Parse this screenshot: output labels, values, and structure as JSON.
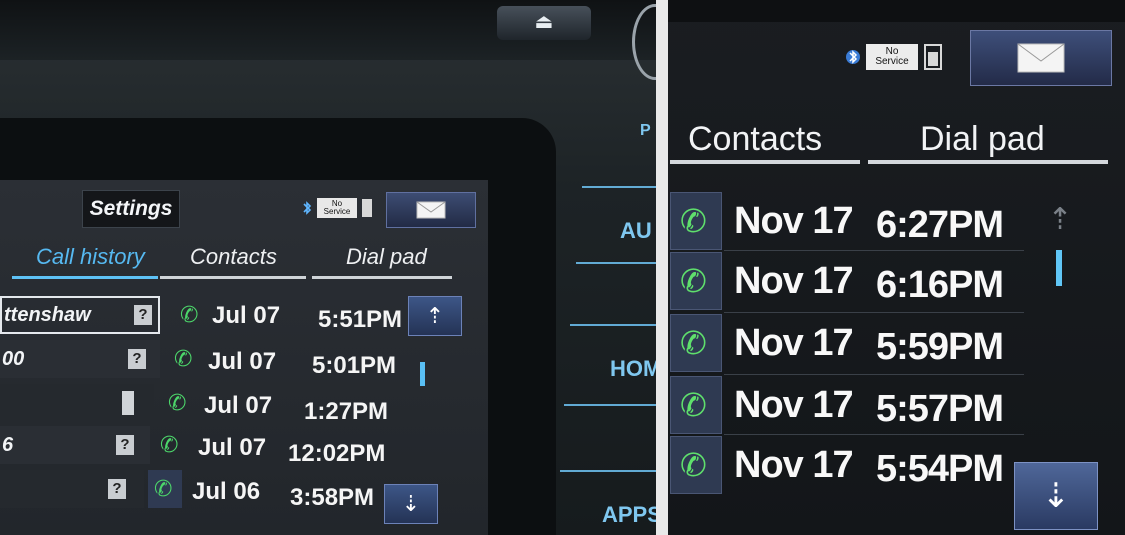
{
  "left_photo": {
    "settings_label": "Settings",
    "status": {
      "no_service": "No Service"
    },
    "tabs": [
      {
        "label": "Call history",
        "active": true
      },
      {
        "label": "Contacts",
        "active": false
      },
      {
        "label": "Dial pad",
        "active": false
      }
    ],
    "history_rows": [
      {
        "name": "ttenshaw",
        "badge": "?",
        "date": "Jul 07",
        "time": "5:51PM"
      },
      {
        "name": "00",
        "badge": "?",
        "date": "Jul 07",
        "time": "5:01PM"
      },
      {
        "name": "",
        "badge": "phone",
        "date": "Jul 07",
        "time": "1:27PM"
      },
      {
        "name": "6",
        "badge": "?",
        "date": "Jul 07",
        "time": "12:02PM"
      },
      {
        "name": "",
        "badge": "?",
        "date": "Jul 06",
        "time": "3:58PM"
      }
    ],
    "hardware_buttons": [
      "AU",
      "HOM",
      "APPS",
      "P"
    ],
    "colors": {
      "accent": "#56b9f1",
      "call_icon": "#4cd66a",
      "scroll_button": "#3d5687"
    }
  },
  "right_photo": {
    "status": {
      "no_service": "No Service"
    },
    "tabs": [
      {
        "label": "Contacts"
      },
      {
        "label": "Dial pad"
      }
    ],
    "calls": [
      {
        "date": "Nov 17",
        "time": "6:27PM"
      },
      {
        "date": "Nov 17",
        "time": "6:16PM"
      },
      {
        "date": "Nov 17",
        "time": "5:59PM"
      },
      {
        "date": "Nov 17",
        "time": "5:57PM"
      },
      {
        "date": "Nov 17",
        "time": "5:54PM"
      }
    ],
    "icons": {
      "call": "phone-icon",
      "scroll_up": "arrow-up-icon",
      "scroll_down": "arrow-down-icon",
      "mail": "envelope-icon",
      "bluetooth": "bluetooth-icon",
      "battery": "battery-icon"
    }
  }
}
